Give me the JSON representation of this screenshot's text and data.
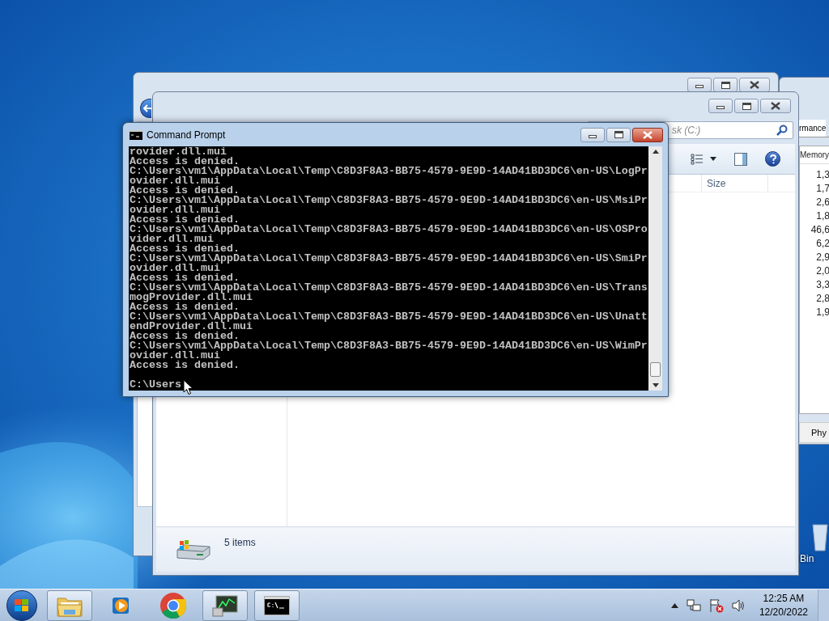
{
  "desktop": {
    "recycle_bin_label": "Bin"
  },
  "task_manager": {
    "active": false,
    "tab_label": "rmance",
    "column_header": "Memory",
    "values": [
      "1,3",
      "1,7",
      "2,6",
      "1,8",
      "46,6",
      "6,2",
      "2,9",
      "2,0",
      "3,3",
      "2,8",
      "1,9"
    ],
    "footer_label": "Phy"
  },
  "explorer_back": {
    "active": false
  },
  "explorer_front": {
    "active": false,
    "search_text": "sk (C:)",
    "column_header": "Size",
    "status_text": "5 items"
  },
  "command_prompt": {
    "active": true,
    "title": "Command Prompt",
    "lines": [
      "rovider.dll.mui",
      "Access is denied.",
      "C:\\Users\\vm1\\AppData\\Local\\Temp\\C8D3F8A3-BB75-4579-9E9D-14AD41BD3DC6\\en-US\\LogPr",
      "ovider.dll.mui",
      "Access is denied.",
      "C:\\Users\\vm1\\AppData\\Local\\Temp\\C8D3F8A3-BB75-4579-9E9D-14AD41BD3DC6\\en-US\\MsiPr",
      "ovider.dll.mui",
      "Access is denied.",
      "C:\\Users\\vm1\\AppData\\Local\\Temp\\C8D3F8A3-BB75-4579-9E9D-14AD41BD3DC6\\en-US\\OSPro",
      "vider.dll.mui",
      "Access is denied.",
      "C:\\Users\\vm1\\AppData\\Local\\Temp\\C8D3F8A3-BB75-4579-9E9D-14AD41BD3DC6\\en-US\\SmiPr",
      "ovider.dll.mui",
      "Access is denied.",
      "C:\\Users\\vm1\\AppData\\Local\\Temp\\C8D3F8A3-BB75-4579-9E9D-14AD41BD3DC6\\en-US\\Trans",
      "mogProvider.dll.mui",
      "Access is denied.",
      "C:\\Users\\vm1\\AppData\\Local\\Temp\\C8D3F8A3-BB75-4579-9E9D-14AD41BD3DC6\\en-US\\Unatt",
      "endProvider.dll.mui",
      "Access is denied.",
      "C:\\Users\\vm1\\AppData\\Local\\Temp\\C8D3F8A3-BB75-4579-9E9D-14AD41BD3DC6\\en-US\\WimPr",
      "ovider.dll.mui",
      "Access is denied."
    ],
    "prompt": "C:\\Users"
  },
  "taskbar": {
    "buttons": [
      {
        "kind": "explorer",
        "running": true
      },
      {
        "kind": "media",
        "running": false
      },
      {
        "kind": "browser",
        "running": false
      },
      {
        "kind": "taskmanager",
        "running": true
      },
      {
        "kind": "console",
        "running": true
      }
    ],
    "clock": {
      "time": "12:25 AM",
      "date": "12/20/2022"
    }
  }
}
